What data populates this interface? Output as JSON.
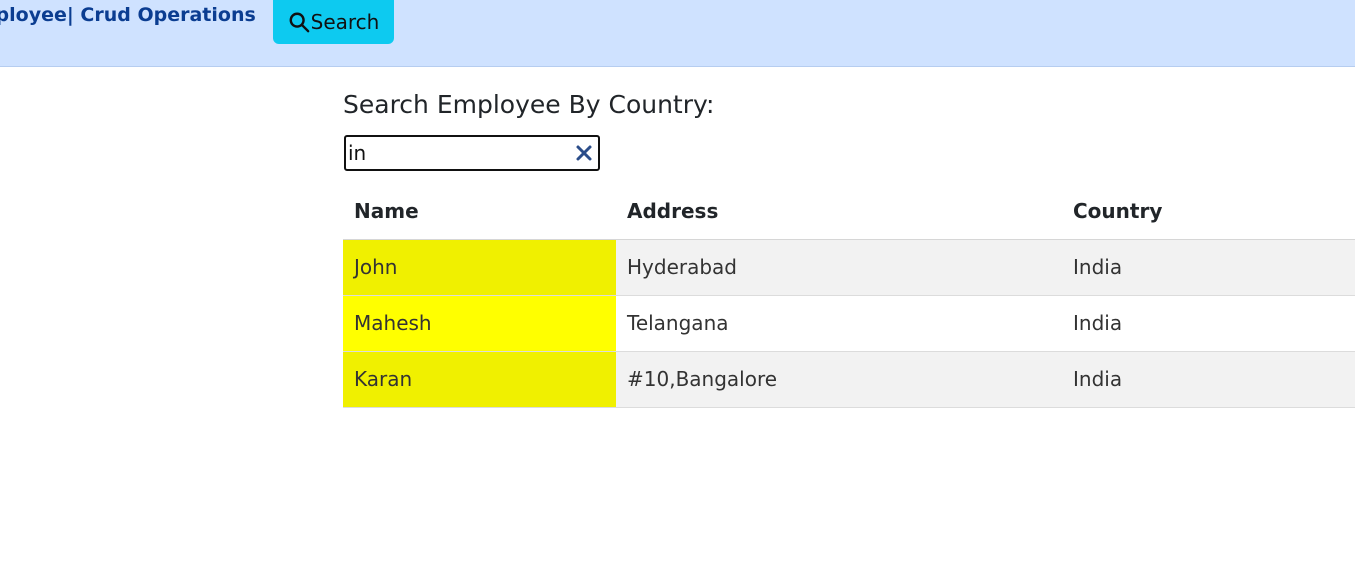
{
  "navbar": {
    "brand": "nployee| Crud Operations",
    "search_button_label": "Search"
  },
  "search": {
    "heading": "Search Employee By Country:",
    "value": "in"
  },
  "table": {
    "headers": [
      "Name",
      "Address",
      "Country"
    ],
    "rows": [
      {
        "name": "John",
        "address": "Hyderabad",
        "country": "India"
      },
      {
        "name": "Mahesh",
        "address": "Telangana",
        "country": "India"
      },
      {
        "name": "Karan",
        "address": "#10,Bangalore",
        "country": "India"
      }
    ]
  },
  "colors": {
    "navbar_bg": "#cfe2ff",
    "brand": "#0b3d91",
    "search_button": "#0dcaf0",
    "highlight": "#ffff00",
    "clear_icon": "#2b4d8a"
  },
  "icons": {
    "search_button_icon": "search-icon",
    "input_clear_icon": "close-icon"
  }
}
